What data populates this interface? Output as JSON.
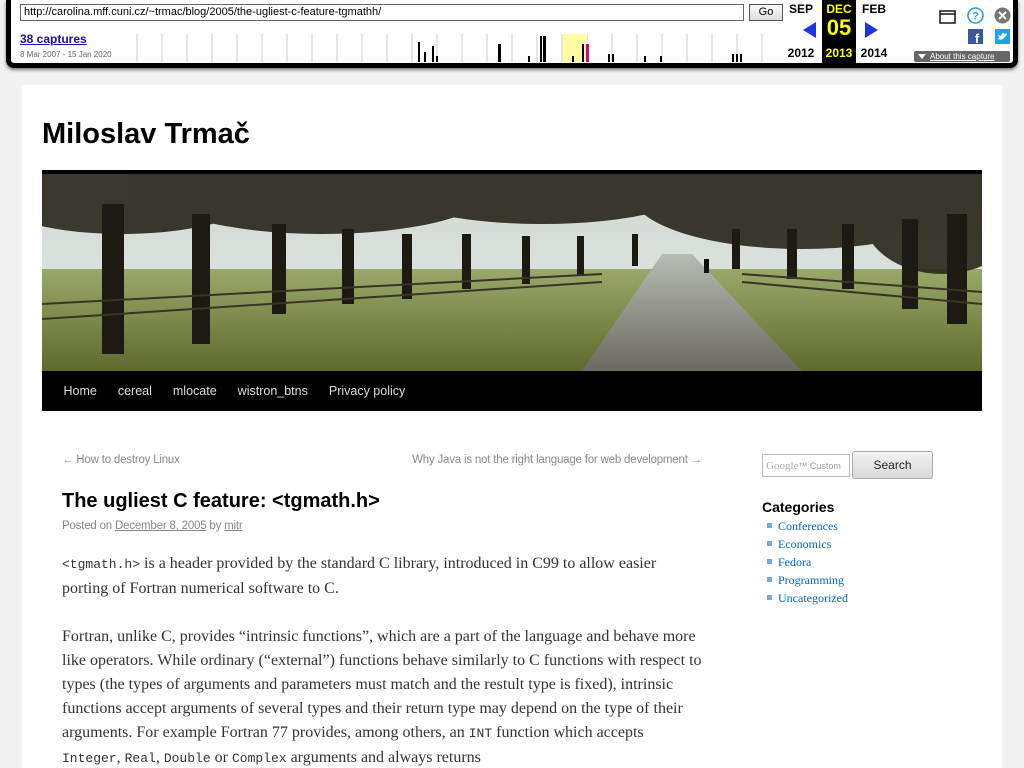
{
  "wayback": {
    "url": "http://carolina.mff.cuni.cz/~trmac/blog/2005/the-ugliest-c-feature-tgmathh/",
    "go_label": "Go",
    "captures": "38 captures",
    "range": "8 Mar 2007 - 15 Jan 2020",
    "prev": {
      "month": "SEP",
      "year": "2012"
    },
    "current": {
      "month": "DEC",
      "day": "05",
      "year": "2013"
    },
    "next": {
      "month": "FEB",
      "year": "2014"
    },
    "about_label": "About this capture"
  },
  "site": {
    "title": "Miloslav Trmač",
    "nav": [
      "Home",
      "cereal",
      "mlocate",
      "wistron_btns",
      "Privacy policy"
    ]
  },
  "post": {
    "prev_link": "← How to destroy Linux",
    "next_link": "Why Java is not the right language for web development →",
    "title": "The ugliest C feature: <tgmath.h>",
    "meta_posted": "Posted on",
    "meta_date": "December 8, 2005",
    "meta_by": "by",
    "meta_author": "mitr",
    "p1_code": "<tgmath.h>",
    "p1_text": " is a header provided by the standard C library, introduced in C99 to allow easier porting of Fortran numerical software to C.",
    "p2_text": "Fortran, unlike C, provides “intrinsic functions”, which are a part of the language and behave more like operators. While ordinary (“external”) functions behave similarly to C functions with respect to types (the types of arguments and parameters must match and the restult type is fixed), intrinsic functions accept arguments of several types and their return type may depend on the type of their arguments. For example Fortran 77 provides, among others, an",
    "p2_code_int": "INT",
    "p2_text2": " function which accepts ",
    "p2_code_integer": "Integer",
    "p2_comma1": ", ",
    "p2_code_real": "Real",
    "p2_comma2": ", ",
    "p2_code_double": "Double",
    "p2_or": " or ",
    "p2_code_complex": "Complex",
    "p2_text3": " arguments and always returns"
  },
  "sidebar": {
    "search_google": "Google",
    "search_custom": "Custom",
    "search_button": "Search",
    "categories_title": "Categories",
    "categories": [
      "Conferences",
      "Economics",
      "Fedora",
      "Programming",
      "Uncategorized"
    ]
  }
}
